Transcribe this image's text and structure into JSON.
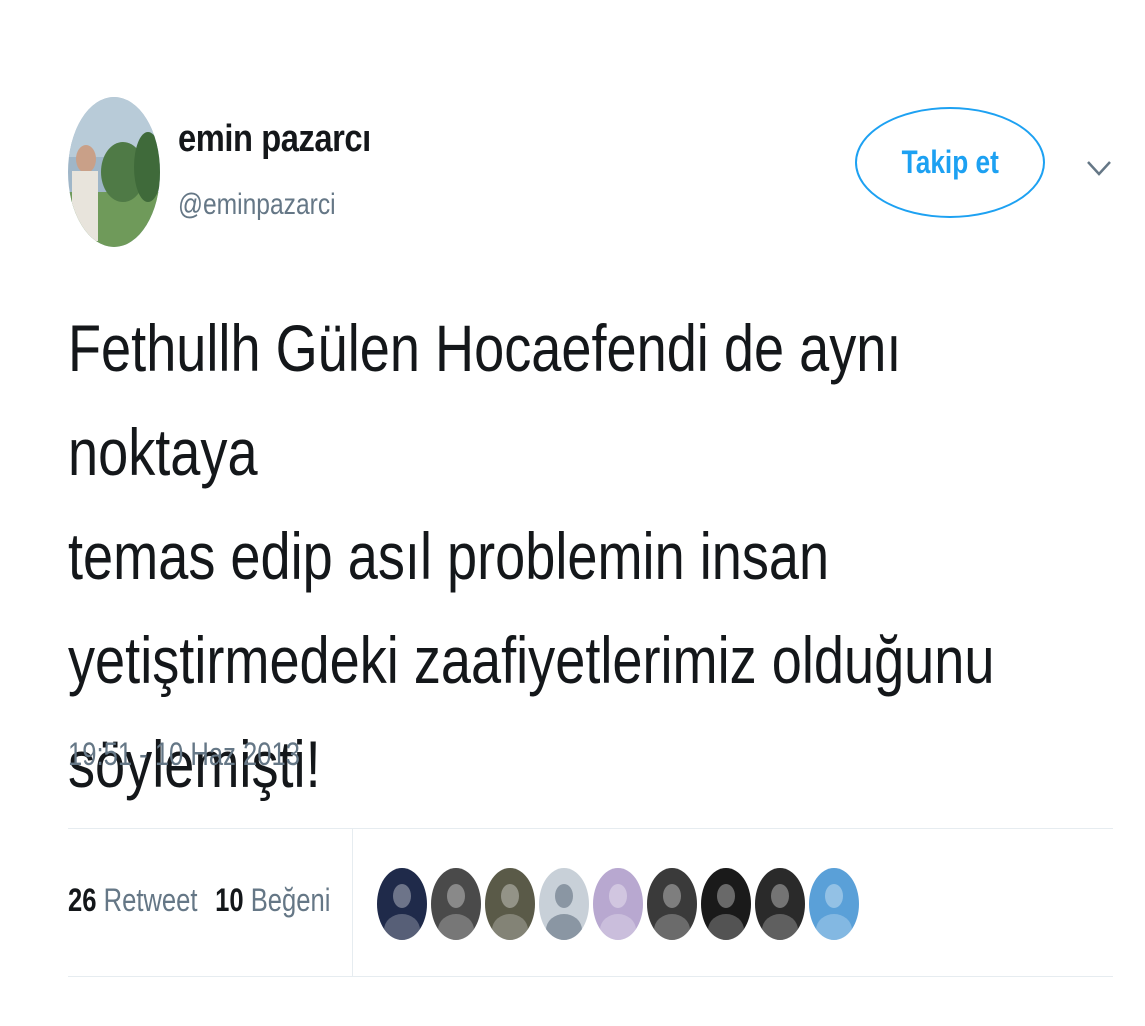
{
  "user": {
    "display_name": "emin pazarcı",
    "handle": "@eminpazarci",
    "avatar_icon": "profile-photo"
  },
  "follow_button": {
    "label": "Takip et"
  },
  "menu": {
    "icon": "chevron-down-icon"
  },
  "tweet": {
    "text": "Fethullh Gülen Hocaefendi de aynı noktaya\ntemas edip asıl problemin insan\nyetiştirmedeki zaafiyetlerimiz olduğunu\nsöylemişti!",
    "timestamp": "19:51 - 10 Haz 2013"
  },
  "stats": {
    "retweet_count": "26",
    "retweet_label": "Retweet",
    "like_count": "10",
    "like_label": "Beğeni"
  },
  "likers": [
    {
      "name": "liker-avatar-1",
      "color": "#1f2a4a"
    },
    {
      "name": "liker-avatar-2",
      "color": "#4a4a4a"
    },
    {
      "name": "liker-avatar-3",
      "color": "#5a5a48"
    },
    {
      "name": "liker-avatar-4",
      "color": "#c8d0d8"
    },
    {
      "name": "liker-avatar-5",
      "color": "#b8a8d0"
    },
    {
      "name": "liker-avatar-6",
      "color": "#3a3a3a"
    },
    {
      "name": "liker-avatar-7",
      "color": "#1a1a1a"
    },
    {
      "name": "liker-avatar-8",
      "color": "#2a2a2a"
    },
    {
      "name": "liker-avatar-9",
      "color": "#5aa0d8"
    }
  ],
  "colors": {
    "accent": "#1da1f2",
    "text": "#14171a",
    "muted": "#657786",
    "divider": "#e6ecf0"
  }
}
